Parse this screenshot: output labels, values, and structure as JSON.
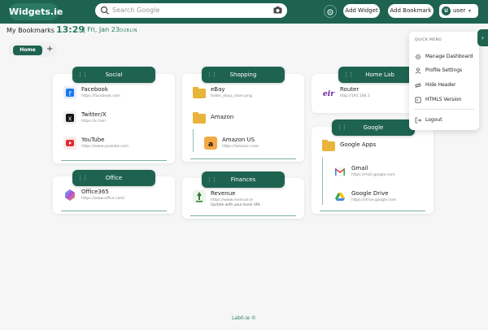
{
  "header": {
    "logo": "Widgets.ie",
    "search_placeholder": "Search Google",
    "add_widget": "Add Widget",
    "add_bookmark": "Add Bookmark",
    "user_initial": "U",
    "user_name": "user"
  },
  "subheader": {
    "title": "My Bookmarks",
    "time": "13:29",
    "date": "| Fri, Jan 23",
    "city": "DUBLIN"
  },
  "tabs": {
    "home": "Home",
    "add": "+"
  },
  "widgets": {
    "social": {
      "title": "Social",
      "items": [
        {
          "name": "Facebook",
          "url": "https://facebook.com"
        },
        {
          "name": "Twitter/X",
          "url": "https://x.com"
        },
        {
          "name": "YouTube",
          "url": "https://www.youtube.com"
        }
      ]
    },
    "office": {
      "title": "Office",
      "items": [
        {
          "name": "Office365",
          "url": "https://www.office.com/"
        }
      ]
    },
    "shopping": {
      "title": "Shopping",
      "items": [
        {
          "name": "eBay",
          "url": "folder_ebay_clean.png"
        },
        {
          "name": "Amazon",
          "url": ""
        },
        {
          "name": "Amazon US",
          "url": "https://amazon.com"
        }
      ]
    },
    "finances": {
      "title": "Finances",
      "items": [
        {
          "name": "Revenue",
          "url": "https://www.revenue.ie",
          "note": "Update with your bank URL"
        }
      ]
    },
    "homelab": {
      "title": "Home Lab",
      "items": [
        {
          "name": "Router",
          "url": "http://192.168.1"
        }
      ]
    },
    "google": {
      "title": "Google",
      "items": [
        {
          "name": "Google Apps",
          "url": ""
        },
        {
          "name": "Gmail",
          "url": "https://mail.google.com"
        },
        {
          "name": "Google Drive",
          "url": "https://drive.google.com"
        }
      ]
    }
  },
  "quick_menu": {
    "title": "QUICK MENU",
    "items": [
      {
        "label": "Manage Dashboard",
        "icon": "gear-icon"
      },
      {
        "label": "Profile Settings",
        "icon": "user-icon"
      },
      {
        "label": "Hide Header",
        "icon": "eye-off-icon"
      },
      {
        "label": "HTML5 Version",
        "icon": "code-icon"
      },
      {
        "label": "Logout",
        "icon": "logout-icon"
      }
    ]
  },
  "side_toggle": "›",
  "footer": "Lab0.ie ©",
  "colors": {
    "primary": "#1e6350",
    "accent": "#2a7a63"
  }
}
